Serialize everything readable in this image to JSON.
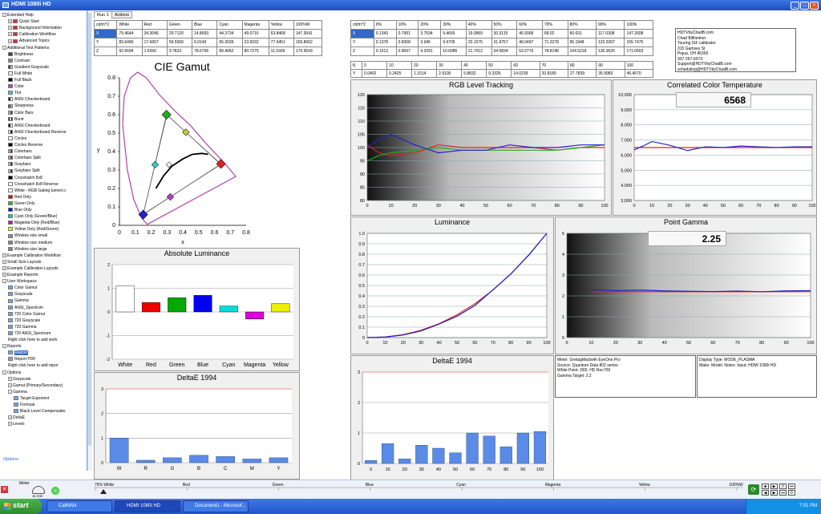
{
  "window": {
    "title": "HDMI 1080i HD",
    "min": "_",
    "max": "□",
    "close": "×"
  },
  "sidebar": {
    "items": [
      {
        "label": "Extended Help",
        "box": "-",
        "icon": "none",
        "level": 0
      },
      {
        "label": "Quick Start",
        "box": "+",
        "icon": "#c33",
        "level": 1
      },
      {
        "label": "Background Information",
        "box": "+",
        "icon": "#c33",
        "level": 1
      },
      {
        "label": "Calibration Workflow",
        "box": "+",
        "icon": "#c33",
        "level": 1
      },
      {
        "label": "Advanced Topics",
        "box": "+",
        "icon": "#c33",
        "level": 1
      },
      {
        "label": "Additional Test Patterns",
        "box": "-",
        "icon": "none",
        "level": 0
      },
      {
        "label": "Brightness",
        "box": "",
        "icon": "#444",
        "level": 1
      },
      {
        "label": "Contrast",
        "box": "",
        "icon": "#888",
        "level": 1
      },
      {
        "label": "Gradient Grayscale",
        "box": "",
        "icon": "linear-gradient(90deg,#000,#fff)",
        "level": 1
      },
      {
        "label": "Full White",
        "box": "",
        "icon": "#fff",
        "level": 1
      },
      {
        "label": "Full Black",
        "box": "",
        "icon": "#000",
        "level": 1
      },
      {
        "label": "Color",
        "box": "",
        "icon": "#c3c",
        "level": 1
      },
      {
        "label": "Tint",
        "box": "",
        "icon": "#3cc",
        "level": 1
      },
      {
        "label": "ANSI Checkerboard",
        "box": "",
        "icon": "repeating-linear-gradient(90deg,#000 0 2px,#fff 2px 4px)",
        "level": 1
      },
      {
        "label": "Sharpness",
        "box": "",
        "icon": "repeating-linear-gradient(90deg,#000 0 1px,#fff 1px 2px)",
        "level": 1
      },
      {
        "label": "Color Bars",
        "box": "",
        "icon": "linear-gradient(90deg,#ff0,#0ff,#0f0,#f0f,#f00,#00f)",
        "level": 1
      },
      {
        "label": "Burst",
        "box": "",
        "icon": "repeating-linear-gradient(90deg,#000 0 1px,#fff 1px 3px)",
        "level": 1
      },
      {
        "label": "ANSI Checkerboard",
        "box": "",
        "icon": "repeating-linear-gradient(90deg,#000 0 2px,#fff 2px 4px)",
        "level": 1
      },
      {
        "label": "ANSI Checkerboard Reverse",
        "box": "",
        "icon": "repeating-linear-gradient(90deg,#fff 0 2px,#000 2px 4px)",
        "level": 1
      },
      {
        "label": "Circles",
        "box": "",
        "icon": "#fff",
        "level": 1
      },
      {
        "label": "Circles Reverse",
        "box": "",
        "icon": "#000",
        "level": 1
      },
      {
        "label": "Colorbars",
        "box": "",
        "icon": "linear-gradient(90deg,#ff0,#0ff,#0f0,#f0f,#f00,#00f)",
        "level": 1
      },
      {
        "label": "Colorbars Split",
        "box": "",
        "icon": "linear-gradient(90deg,#ff0,#0ff,#0f0,#f0f,#f00,#00f)",
        "level": 1
      },
      {
        "label": "Graybars",
        "box": "",
        "icon": "linear-gradient(90deg,#fff,#000)",
        "level": 1
      },
      {
        "label": "Graybars Split",
        "box": "",
        "icon": "linear-gradient(90deg,#fff,#000)",
        "level": 1
      },
      {
        "label": "Crosshatch 8x8",
        "box": "",
        "icon": "#000",
        "level": 1
      },
      {
        "label": "Crosshatch 8x8 Reverse",
        "box": "",
        "icon": "#fff",
        "level": 1
      },
      {
        "label": "White - RGB Gating turned o",
        "box": "",
        "icon": "#fff",
        "level": 1
      },
      {
        "label": "Red Only",
        "box": "",
        "icon": "#e00",
        "level": 1
      },
      {
        "label": "Green Only",
        "box": "",
        "icon": "#0c0",
        "level": 1
      },
      {
        "label": "Blue Only",
        "box": "",
        "icon": "#00e",
        "level": 1
      },
      {
        "label": "Cyan Only (Green/Blue)",
        "box": "",
        "icon": "#0cc",
        "level": 1
      },
      {
        "label": "Magenta Only (Red/Blue)",
        "box": "",
        "icon": "#c0c",
        "level": 1
      },
      {
        "label": "Yellow Only (Red/Green)",
        "box": "",
        "icon": "#ee0",
        "level": 1
      },
      {
        "label": "Window size small",
        "box": "",
        "icon": "#888",
        "level": 1
      },
      {
        "label": "Window size medium",
        "box": "",
        "icon": "#888",
        "level": 1
      },
      {
        "label": "Window size large",
        "box": "",
        "icon": "#888",
        "level": 1
      },
      {
        "label": "Example Calibration Workflow",
        "box": "+",
        "icon": "none",
        "level": 0
      },
      {
        "label": "Small Size Layouts",
        "box": "+",
        "icon": "none",
        "level": 0
      },
      {
        "label": "Example Calibration Layouts",
        "box": "+",
        "icon": "none",
        "level": 0
      },
      {
        "label": "Example Reports",
        "box": "+",
        "icon": "none",
        "level": 0
      },
      {
        "label": "User Workspace",
        "box": "-",
        "icon": "none",
        "level": 0
      },
      {
        "label": "Color Gamut",
        "box": "",
        "icon": "#6ae",
        "level": 1
      },
      {
        "label": "Grayscale",
        "box": "",
        "icon": "#6ae",
        "level": 1
      },
      {
        "label": "Gamma",
        "box": "",
        "icon": "#6ae",
        "level": 1
      },
      {
        "label": "ANSI_Spectrum",
        "box": "",
        "icon": "#6ae",
        "level": 1
      },
      {
        "label": "720 Color Gamut",
        "box": "",
        "icon": "#6ae",
        "level": 1
      },
      {
        "label": "720 Grayscale",
        "box": "",
        "icon": "#6ae",
        "level": 1
      },
      {
        "label": "720 Gamma",
        "box": "",
        "icon": "#6ae",
        "level": 1
      },
      {
        "label": "720 ANSI_Spectrum",
        "box": "",
        "icon": "#6ae",
        "level": 1
      },
      {
        "label": "Right click here to add work",
        "box": "",
        "icon": "none",
        "level": 1
      },
      {
        "label": "Reports",
        "box": "-",
        "icon": "none",
        "level": 0
      },
      {
        "label": "Report",
        "box": "",
        "icon": "#6ae",
        "level": 1,
        "selected": true
      },
      {
        "label": "Report PDF",
        "box": "",
        "icon": "#6ae",
        "level": 1
      },
      {
        "label": "Right click here to add repor",
        "box": "",
        "icon": "none",
        "level": 1
      },
      {
        "label": "Options",
        "box": "-",
        "icon": "none",
        "level": 0
      },
      {
        "label": "Grayscale",
        "box": "+",
        "icon": "none",
        "level": 1
      },
      {
        "label": "Gamut (Primary/Secondary)",
        "box": "+",
        "icon": "none",
        "level": 1
      },
      {
        "label": "Gamma",
        "box": "-",
        "icon": "none",
        "level": 1
      },
      {
        "label": "Target Exponent",
        "box": "",
        "icon": "#6ae",
        "level": 2
      },
      {
        "label": "Formula",
        "box": "",
        "icon": "#6ae",
        "level": 2
      },
      {
        "label": "Black Level Compensatio",
        "box": "",
        "icon": "#6ae",
        "level": 2
      },
      {
        "label": "DeltaE",
        "box": "+",
        "icon": "none",
        "level": 1
      },
      {
        "label": "Levels",
        "box": "+",
        "icon": "none",
        "level": 1
      }
    ],
    "options_label": "Options"
  },
  "tabs": [
    "Run 1",
    "Actions"
  ],
  "table1": {
    "headers": [
      "cd/m^2",
      "White",
      "Red",
      "Green",
      "Blue",
      "Cyan",
      "Magenta",
      "Yellow",
      "100%W"
    ],
    "rows": [
      [
        "X",
        "79.4644",
        "34.3046",
        "29.7120",
        "14.8093",
        "44.3734",
        "49.0716",
        "63.8468",
        "147.3641"
      ],
      [
        "Y",
        "83.6490",
        "17.6657",
        "59.5569",
        "6.0149",
        "65.3039",
        "23.5032",
        "77.0451",
        "155.8062"
      ],
      [
        "Z",
        "92.6694",
        "1.6260",
        "9.7823",
        "78.6756",
        "89.4062",
        "80.7275",
        "11.1669",
        "170.9543"
      ]
    ]
  },
  "table2": {
    "headers": [
      "cd/m^2",
      "0%",
      "10%",
      "20%",
      "30%",
      "40%",
      "50%",
      "60%",
      "70%",
      "80%",
      "90%",
      "100%"
    ],
    "rows": [
      [
        "X",
        "0.1343",
        "0.7991",
        "3.7534",
        "9.4665",
        "19.0969",
        "30.3115",
        "45.9368",
        "68.02",
        "90.631",
        "117.0308",
        "147.2608"
      ],
      [
        "Y",
        "0.1378",
        "0.8308",
        "3.945",
        "9.9705",
        "20.1575",
        "31.9757",
        "48.0497",
        "71.3278",
        "95.1948",
        "123.3397",
        "155.7475"
      ],
      [
        "Z",
        "0.1513",
        "0.9697",
        "4.3291",
        "10.6085",
        "21.7012",
        "34.5834",
        "53.2776",
        "78.8148",
        "104.5218",
        "136.3526",
        "171.0503"
      ]
    ]
  },
  "table3": {
    "headers": [
      "fL",
      "0",
      "10",
      "20",
      "30",
      "40",
      "50",
      "60",
      "70",
      "80",
      "90",
      "100"
    ],
    "rows": [
      [
        "Y",
        "0.0402",
        "0.2425",
        "1.1514",
        "2.9100",
        "5.8832",
        "9.3325",
        "14.0239",
        "20.8180",
        "27.7839",
        "35.9983",
        "45.4570"
      ]
    ]
  },
  "contact": {
    "lines": [
      "HDTVbyChadB.com",
      "Chad Billheimer",
      "Touring ISF calibrator",
      "315 Gamsey St",
      "Piqua, OH 45356",
      "937-267-6073",
      "Support@HDTVbyChadB.com",
      "scheduling@HDTVbyChadB.com"
    ]
  },
  "meter_info": {
    "lines": [
      "Meter: GretagMacbeth EyeOne Pro",
      "Source: Quantum Data 802 series",
      "White Point: D65, HD Rec709",
      "Gamma Target: 2.2"
    ]
  },
  "display_info": {
    "lines": [
      "Display Type: MODE_PLASMA",
      "Make: Model: Notes: Input: HDMI 1080i HD"
    ]
  },
  "cie": {
    "title": "CIE Gamut",
    "xlabel": "x",
    "ylabel": "y",
    "xticks": [
      "0",
      "0.1",
      "0.2",
      "0.3",
      "0.4",
      "0.5",
      "0.6",
      "0.7",
      "0.8"
    ],
    "yticks": [
      "0",
      "0.1",
      "0.2",
      "0.3",
      "0.4",
      "0.5",
      "0.6",
      "0.7",
      "0.8"
    ]
  },
  "abs_lum": {
    "title": "Absolute Luminance",
    "categories": [
      "White",
      "Red",
      "Green",
      "Blue",
      "Cyan",
      "Magenta",
      "Yellow"
    ],
    "yticks": [
      "-2",
      "-1",
      "0",
      "1",
      "2"
    ]
  },
  "deltae1": {
    "title": "DeltaE 1994",
    "categories": [
      "W",
      "R",
      "G",
      "B",
      "C",
      "M",
      "Y"
    ],
    "yticks": [
      "0",
      "1",
      "2",
      "3"
    ]
  },
  "rgb": {
    "title": "RGB Level Tracking",
    "yticks": [
      "80",
      "85",
      "90",
      "95",
      "100",
      "105",
      "110",
      "115",
      "120"
    ],
    "xticks": [
      "0",
      "10",
      "20",
      "30",
      "40",
      "50",
      "60",
      "70",
      "80",
      "90",
      "100"
    ]
  },
  "cct": {
    "title": "Correlated Color Temperature",
    "value": "6568",
    "yticks": [
      "3,000",
      "4,000",
      "5,000",
      "6,000",
      "7,000",
      "8,000",
      "9,000",
      "10,000"
    ],
    "xticks": [
      "0",
      "10",
      "20",
      "30",
      "40",
      "50",
      "60",
      "70",
      "80",
      "90",
      "100"
    ]
  },
  "lum": {
    "title": "Luminance",
    "yticks": [
      "0",
      "0.1",
      "0.2",
      "0.3",
      "0.4",
      "0.5",
      "0.6",
      "0.7",
      "0.8",
      "0.9",
      "1.0"
    ],
    "xticks": [
      "0",
      "10",
      "20",
      "30",
      "40",
      "50",
      "60",
      "70",
      "80",
      "90",
      "100"
    ]
  },
  "gamma": {
    "title": "Point Gamma",
    "value": "2.25",
    "yticks": [
      "0",
      "1",
      "2",
      "3",
      "4",
      "5"
    ],
    "xticks": [
      "0",
      "10",
      "20",
      "30",
      "40",
      "50",
      "60",
      "70",
      "80",
      "90",
      "100"
    ]
  },
  "deltae2": {
    "title": "DeltaE 1994",
    "categories": [
      "0",
      "10",
      "20",
      "30",
      "40",
      "50",
      "60",
      "70",
      "80",
      "90",
      "100"
    ],
    "yticks": [
      "0",
      "1",
      "2",
      "3"
    ]
  },
  "status": {
    "meter_label": "Meter",
    "meter_value": "11 min",
    "scale": [
      "75% White",
      "Red",
      "Green",
      "Blue",
      "Cyan",
      "Magenta",
      "Yellow",
      "100%W"
    ]
  },
  "taskbar": {
    "start": "start",
    "tasks": [
      "CalMAN",
      "HDMI 1080i HD",
      "Document1 - Microsof..."
    ],
    "clock": "7:01 PM"
  },
  "chart_data": [
    {
      "type": "scatter",
      "title": "CIE Gamut",
      "xlabel": "x",
      "ylabel": "y",
      "xlim": [
        0,
        0.8
      ],
      "ylim": [
        0,
        0.8
      ],
      "series": [
        {
          "values": [
            [
              0.64,
              0.33
            ],
            [
              0.3,
              0.6
            ],
            [
              0.15,
              0.06
            ],
            [
              0.64,
              0.33
            ]
          ]
        },
        {
          "values": [
            [
              0.641,
              0.333
            ],
            [
              0.297,
              0.6
            ],
            [
              0.15,
              0.058
            ],
            [
              0.641,
              0.333
            ]
          ]
        },
        {
          "values": [
            [
              0.225,
              0.329
            ],
            [
              0.321,
              0.154
            ],
            [
              0.419,
              0.505
            ]
          ]
        },
        {
          "values": [
            [
              0.313,
              0.329
            ]
          ]
        }
      ]
    },
    {
      "type": "bar",
      "title": "Absolute Luminance",
      "categories": [
        "White",
        "Red",
        "Green",
        "Blue",
        "Cyan",
        "Magenta",
        "Yellow"
      ],
      "values": [
        1.1,
        0.4,
        0.6,
        0.7,
        0.25,
        -0.3,
        0.35
      ],
      "ylim": [
        -2,
        2
      ]
    },
    {
      "type": "bar",
      "title": "DeltaE 1994",
      "categories": [
        "W",
        "R",
        "G",
        "B",
        "C",
        "M",
        "Y"
      ],
      "values": [
        1.0,
        0.1,
        0.2,
        0.3,
        0.25,
        0.15,
        0.2
      ],
      "ylim": [
        0,
        3
      ]
    },
    {
      "type": "line",
      "title": "RGB Level Tracking",
      "x": [
        0,
        5,
        10,
        20,
        30,
        40,
        50,
        60,
        70,
        80,
        90,
        100
      ],
      "ylim": [
        80,
        120
      ],
      "series": [
        {
          "name": "Red",
          "values": [
            101,
            98,
            97,
            98,
            101,
            100,
            100,
            100,
            100,
            99,
            100,
            100
          ]
        },
        {
          "name": "Green",
          "values": [
            95,
            97,
            98,
            99,
            100,
            99,
            99,
            99,
            99,
            99,
            100,
            101
          ]
        },
        {
          "name": "Blue",
          "values": [
            100,
            103,
            105,
            101,
            98,
            99,
            99,
            101,
            100,
            100,
            101,
            101
          ]
        }
      ]
    },
    {
      "type": "line",
      "title": "Correlated Color Temperature",
      "x": [
        0,
        5,
        10,
        20,
        30,
        40,
        50,
        60,
        70,
        80,
        90,
        100
      ],
      "ylim": [
        3000,
        10000
      ],
      "series": [
        {
          "name": "Target",
          "values": [
            6500,
            6500,
            6500,
            6500,
            6500,
            6500,
            6500,
            6500,
            6500,
            6500,
            6500,
            6500
          ]
        },
        {
          "name": "Measured",
          "values": [
            6350,
            6600,
            6900,
            6650,
            6300,
            6550,
            6500,
            6600,
            6550,
            6500,
            6550,
            6550
          ]
        }
      ]
    },
    {
      "type": "line",
      "title": "Luminance",
      "x": [
        0,
        10,
        20,
        30,
        40,
        50,
        60,
        70,
        80,
        90,
        100
      ],
      "ylim": [
        0,
        1
      ],
      "series": [
        {
          "name": "Target",
          "values": [
            0,
            0.006,
            0.028,
            0.071,
            0.133,
            0.218,
            0.325,
            0.456,
            0.612,
            0.793,
            1.0
          ]
        },
        {
          "name": "Measured",
          "values": [
            0,
            0.005,
            0.025,
            0.064,
            0.129,
            0.205,
            0.308,
            0.458,
            0.611,
            0.792,
            1.0
          ]
        }
      ]
    },
    {
      "type": "line",
      "title": "Point Gamma",
      "x": [
        10,
        20,
        30,
        40,
        50,
        60,
        70,
        80,
        90,
        100
      ],
      "ylim": [
        0,
        5
      ],
      "series": [
        {
          "name": "Target",
          "values": [
            2.2,
            2.2,
            2.2,
            2.2,
            2.2,
            2.2,
            2.2,
            2.2,
            2.2,
            2.2
          ]
        },
        {
          "name": "Measured",
          "values": [
            2.3,
            2.25,
            2.28,
            2.24,
            2.22,
            2.21,
            2.23,
            2.2,
            2.24,
            2.25
          ]
        }
      ]
    },
    {
      "type": "bar",
      "title": "DeltaE 1994",
      "categories": [
        "0",
        "10",
        "20",
        "30",
        "40",
        "50",
        "60",
        "70",
        "80",
        "90",
        "100"
      ],
      "values": [
        0.1,
        0.65,
        0.15,
        0.6,
        0.5,
        0.35,
        1.0,
        0.9,
        0.55,
        1.0,
        1.05
      ],
      "ylim": [
        0,
        3
      ]
    }
  ]
}
